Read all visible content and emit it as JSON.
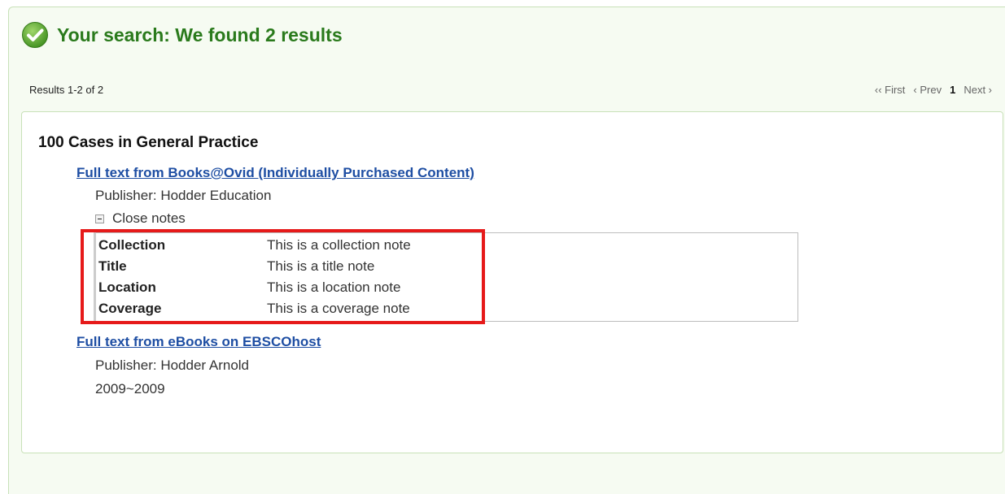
{
  "header": {
    "title": "Your search: We found 2 results",
    "icon": "check-circle-icon",
    "accent_color": "#2a7a1c"
  },
  "results_count": "Results 1-2 of 2",
  "pager": {
    "first": "‹‹ First",
    "prev": "‹ Prev",
    "current": "1",
    "next": "Next ›"
  },
  "record": {
    "title": "100 Cases in General Practice",
    "sources": [
      {
        "link": "Full text from Books@Ovid (Individually Purchased Content)",
        "publisher": "Publisher: Hodder Education",
        "notes_toggle": "Close notes",
        "notes": [
          {
            "label": "Collection",
            "value": "This is a collection note"
          },
          {
            "label": "Title",
            "value": "This is a title note"
          },
          {
            "label": "Location",
            "value": "This is a location note"
          },
          {
            "label": "Coverage",
            "value": "This is a coverage note"
          }
        ]
      },
      {
        "link": "Full text from eBooks on EBSCOhost",
        "publisher": "Publisher: Hodder Arnold",
        "coverage": "2009~2009"
      }
    ]
  },
  "highlight_color": "#e61a1a",
  "link_color": "#1e4ea3"
}
